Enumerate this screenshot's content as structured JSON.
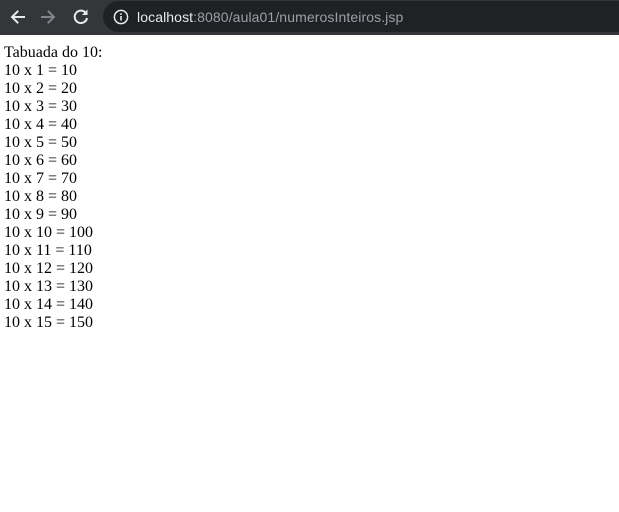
{
  "browser": {
    "url_host": "localhost",
    "url_rest": ":8080/aula01/numerosInteiros.jsp",
    "icons": {
      "back": "arrow-left-icon",
      "forward": "arrow-right-icon",
      "reload": "reload-icon",
      "info": "info-icon"
    },
    "colors": {
      "toolbar": "#35363a",
      "omnibox": "#202124",
      "host_text": "#e8eaed",
      "path_text": "#9aa0a6"
    }
  },
  "page": {
    "title_line": "Tabuada do 10:",
    "rows": [
      "10 x 1 = 10",
      "10 x 2 = 20",
      "10 x 3 = 30",
      "10 x 4 = 40",
      "10 x 5 = 50",
      "10 x 6 = 60",
      "10 x 7 = 70",
      "10 x 8 = 80",
      "10 x 9 = 90",
      "10 x 10 = 100",
      "10 x 11 = 110",
      "10 x 12 = 120",
      "10 x 13 = 130",
      "10 x 14 = 140",
      "10 x 15 = 150"
    ]
  }
}
